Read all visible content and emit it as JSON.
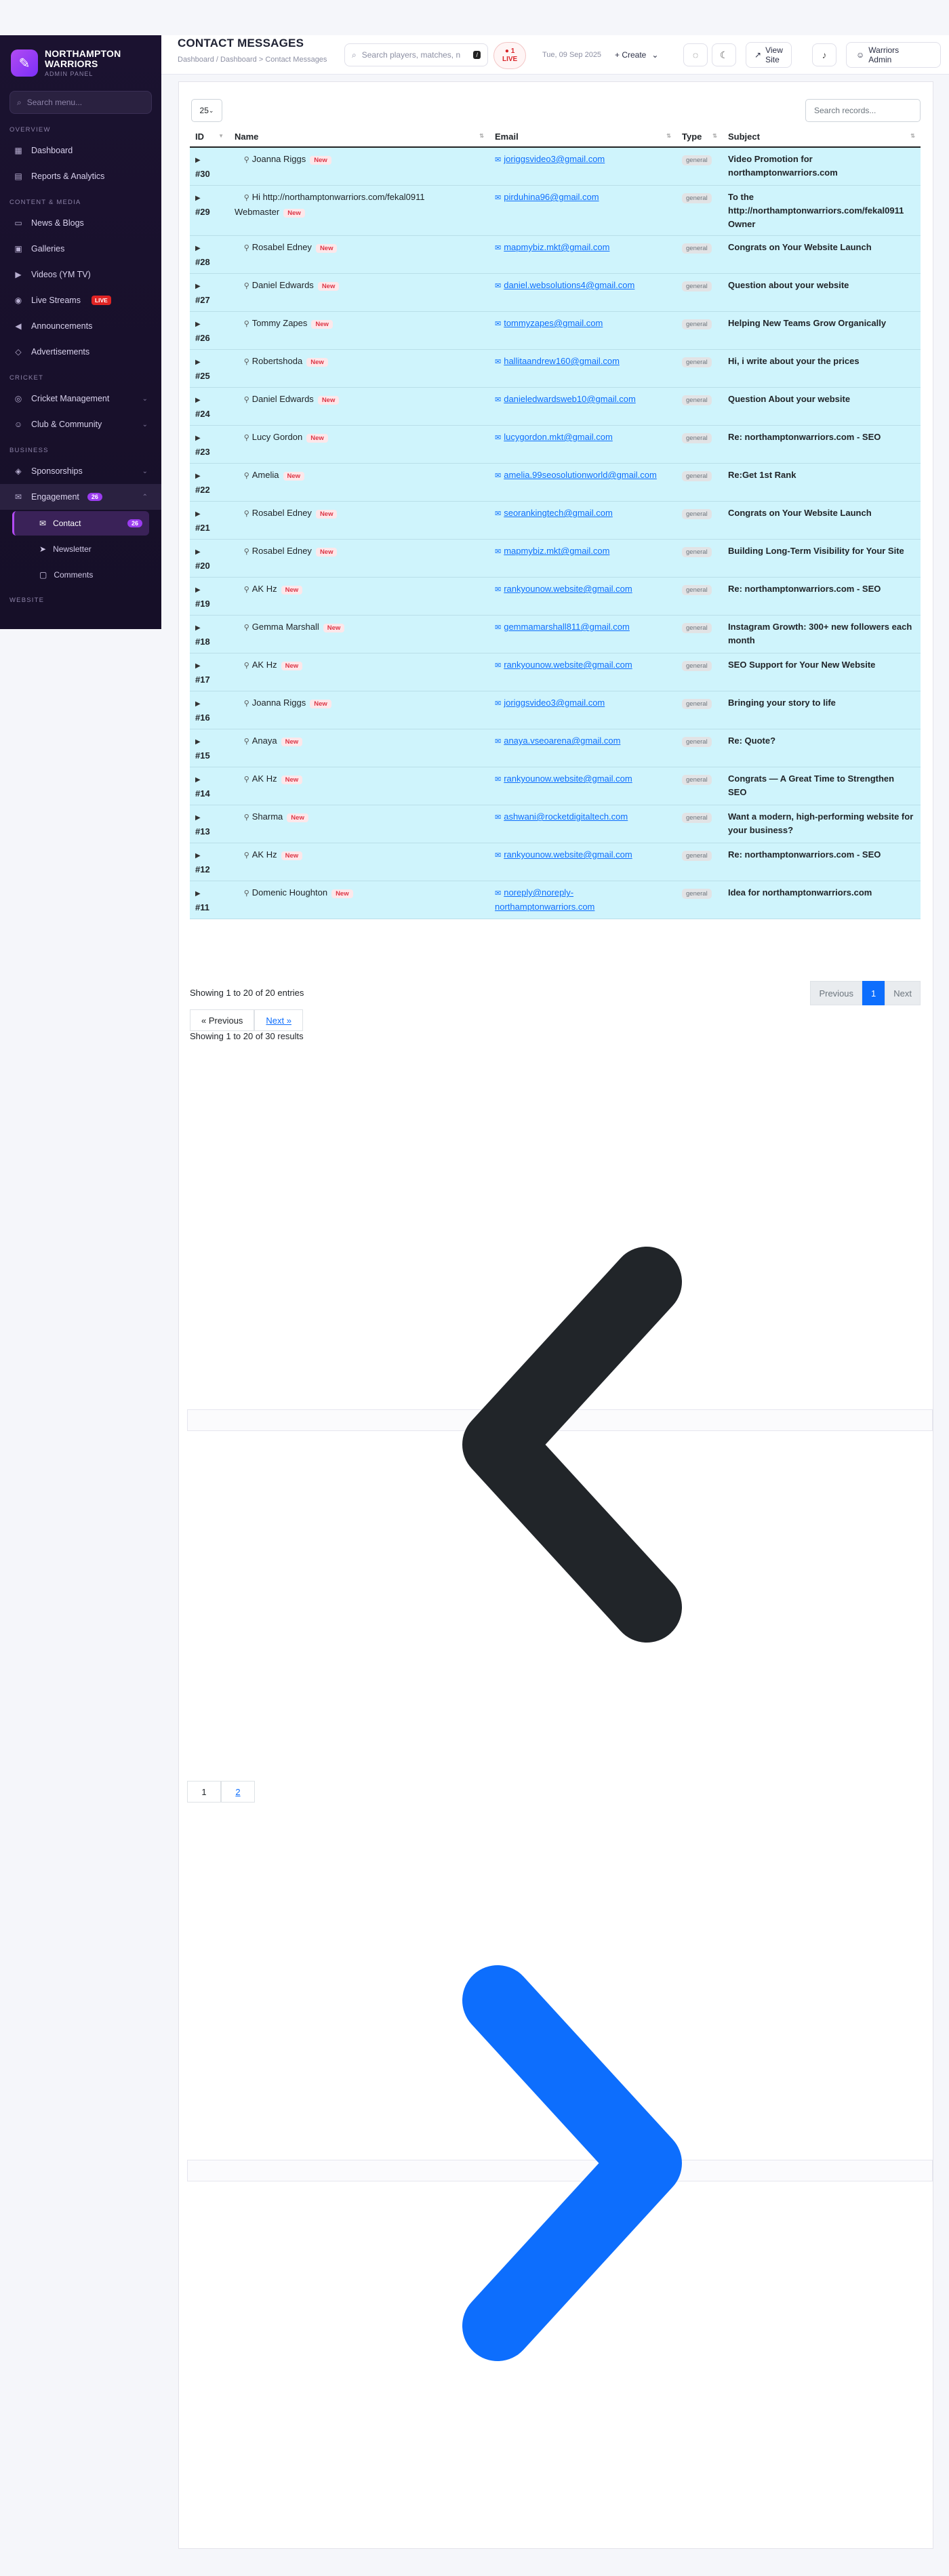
{
  "brand": {
    "name_line1": "NORTHAMPTON",
    "name_line2": "WARRIORS",
    "subtitle": "ADMIN PANEL"
  },
  "sidebar": {
    "search_placeholder": "Search menu...",
    "sections": {
      "overview": "OVERVIEW",
      "content": "CONTENT & MEDIA",
      "cricket": "CRICKET",
      "business": "BUSINESS",
      "website": "WEBSITE"
    },
    "items": {
      "dashboard": "Dashboard",
      "reports": "Reports & Analytics",
      "news": "News & Blogs",
      "galleries": "Galleries",
      "videos": "Videos (YM TV)",
      "live_streams": "Live Streams",
      "live_badge": "LIVE",
      "announcements": "Announcements",
      "advertisements": "Advertisements",
      "cricket_mgmt": "Cricket Management",
      "club": "Club & Community",
      "sponsorships": "Sponsorships",
      "engagement": "Engagement",
      "engagement_badge": "26",
      "contact": "Contact",
      "contact_badge": "26",
      "newsletter": "Newsletter",
      "comments": "Comments"
    }
  },
  "header": {
    "title": "CONTACT MESSAGES",
    "breadcrumb": "Dashboard / Dashboard > Contact Messages",
    "search_placeholder": "Search players, matches, n",
    "kbd": "/",
    "live_line1": "● 1",
    "live_line2": "LIVE",
    "date": "Tue, 09 Sep 2025",
    "create": "+ Create",
    "view_site_1": "View",
    "view_site_2": "Site",
    "admin_1": "Warriors",
    "admin_2": "Admin"
  },
  "table": {
    "length_value": "25",
    "search_placeholder": "Search records...",
    "columns": [
      "ID",
      "Name",
      "Email",
      "Type",
      "Subject"
    ],
    "new_label": "New",
    "rows": [
      {
        "id": "#30",
        "name": "Joanna Riggs",
        "email": "joriggsvideo3@gmail.com",
        "type": "general",
        "subject": "Video Promotion for northamptonwarriors.com"
      },
      {
        "id": "#29",
        "name": "Hi http://northamptonwarriors.com/fekal0911 Webmaster",
        "email": "pirduhina96@gmail.com",
        "type": "general",
        "subject": "To the http://northamptonwarriors.com/fekal0911 Owner"
      },
      {
        "id": "#28",
        "name": "Rosabel Edney",
        "email": "mapmybiz.mkt@gmail.com",
        "type": "general",
        "subject": "Congrats on Your Website Launch"
      },
      {
        "id": "#27",
        "name": "Daniel Edwards",
        "email": "daniel.websolutions4@gmail.com",
        "type": "general",
        "subject": "Question about your website"
      },
      {
        "id": "#26",
        "name": "Tommy Zapes",
        "email": "tommyzapes@gmail.com",
        "type": "general",
        "subject": "Helping New Teams Grow Organically"
      },
      {
        "id": "#25",
        "name": "Robertshoda",
        "email": "hallitaandrew160@gmail.com",
        "type": "general",
        "subject": "Hi, i write about your the prices"
      },
      {
        "id": "#24",
        "name": "Daniel Edwards",
        "email": "danieledwardsweb10@gmail.com",
        "type": "general",
        "subject": "Question About your website"
      },
      {
        "id": "#23",
        "name": "Lucy Gordon",
        "email": "lucygordon.mkt@gmail.com",
        "type": "general",
        "subject": "Re: northamptonwarriors.com - SEO"
      },
      {
        "id": "#22",
        "name": "Amelia",
        "email": "amelia.99seosolutionworld@gmail.com",
        "type": "general",
        "subject": "Re:Get 1st Rank"
      },
      {
        "id": "#21",
        "name": "Rosabel Edney",
        "email": "seorankingtech@gmail.com",
        "type": "general",
        "subject": "Congrats on Your Website Launch"
      },
      {
        "id": "#20",
        "name": "Rosabel Edney",
        "email": "mapmybiz.mkt@gmail.com",
        "type": "general",
        "subject": "Building Long-Term Visibility for Your Site"
      },
      {
        "id": "#19",
        "name": "AK Hz",
        "email": "rankyounow.website@gmail.com",
        "type": "general",
        "subject": "Re: northamptonwarriors.com - SEO"
      },
      {
        "id": "#18",
        "name": "Gemma Marshall",
        "email": "gemmamarshall811@gmail.com",
        "type": "general",
        "subject": "Instagram Growth: 300+ new followers each month"
      },
      {
        "id": "#17",
        "name": "AK Hz",
        "email": "rankyounow.website@gmail.com",
        "type": "general",
        "subject": "SEO Support for Your New Website"
      },
      {
        "id": "#16",
        "name": "Joanna Riggs",
        "email": "joriggsvideo3@gmail.com",
        "type": "general",
        "subject": "Bringing your story to life"
      },
      {
        "id": "#15",
        "name": "Anaya",
        "email": "anaya.vseoarena@gmail.com",
        "type": "general",
        "subject": "Re: Quote?"
      },
      {
        "id": "#14",
        "name": "AK Hz",
        "email": "rankyounow.website@gmail.com",
        "type": "general",
        "subject": "Congrats — A Great Time to Strengthen SEO"
      },
      {
        "id": "#13",
        "name": "Sharma",
        "email": "ashwani@rocketdigitaltech.com",
        "type": "general",
        "subject": "Want a modern, high-performing website for your business?"
      },
      {
        "id": "#12",
        "name": "AK Hz",
        "email": "rankyounow.website@gmail.com",
        "type": "general",
        "subject": "Re: northamptonwarriors.com - SEO"
      },
      {
        "id": "#11",
        "name": "Domenic Houghton",
        "email": "noreply@noreply-northamptonwarriors.com",
        "type": "general",
        "subject": "Idea for northamptonwarriors.com"
      }
    ]
  },
  "footer": {
    "info": "Showing 1 to 20 of 20 entries",
    "prev": "Previous",
    "page": "1",
    "next": "Next",
    "laravel_prev": "« Previous",
    "laravel_next": "Next »",
    "results": "Showing 1 to 20 of 30 results",
    "num_page1": "1",
    "num_page2": "2"
  },
  "colors": {
    "accent": "#9b3cf0",
    "row_bg": "#cff4fc",
    "link": "#0d6efd",
    "new_badge": "#dc3545"
  }
}
